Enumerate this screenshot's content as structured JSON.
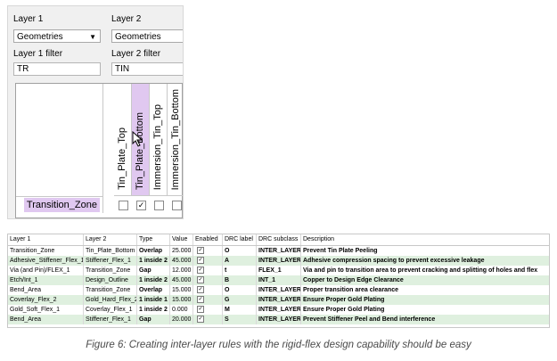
{
  "selector": {
    "layer1_label": "Layer 1",
    "layer2_label": "Layer 2",
    "layer1_value": "Geometries",
    "layer2_value": "Geometries",
    "layer1_filter_label": "Layer 1 filter",
    "layer2_filter_label": "Layer 2 filter",
    "layer1_filter_value": "TR",
    "layer2_filter_value": "TIN"
  },
  "matrix": {
    "columns": [
      "Tin_Plate_Top",
      "Tin_Plate_Bottom",
      "Immersion_Tin_Top",
      "Immersion_Tin_Bottom"
    ],
    "row": "Transition_Zone",
    "checked": [
      false,
      true,
      false,
      false
    ],
    "selected_column": 1,
    "check_glyph": "✓"
  },
  "table": {
    "headers": [
      "Layer 1",
      "Layer 2",
      "Type",
      "Value",
      "Enabled",
      "DRC label",
      "DRC subclass",
      "Description"
    ],
    "rows": [
      [
        "Transition_Zone",
        "Tin_Plate_Bottom",
        "Overlap",
        "25.000",
        "✓",
        "O",
        "INTER_LAYER",
        "Prevent Tin Plate Peeling"
      ],
      [
        "Adhesive_Stiffener_Flex_1",
        "Stiffener_Flex_1",
        "1 inside 2",
        "45.000",
        "✓",
        "A",
        "INTER_LAYER",
        "Adhesive compression spacing to prevent excessive leakage"
      ],
      [
        "Via (and Pin)/FLEX_1",
        "Transition_Zone",
        "Gap",
        "12.000",
        "✓",
        "t",
        "FLEX_1",
        "Via and pin to transition area to prevent cracking and splitting of holes and flex"
      ],
      [
        "Etch/Int_1",
        "Design_Outline",
        "1 inside 2",
        "45.000",
        "✓",
        "B",
        "INT_1",
        "Copper to Design Edge Clearance"
      ],
      [
        "Bend_Area",
        "Transition_Zone",
        "Overlap",
        "15.000",
        "✓",
        "O",
        "INTER_LAYER",
        "Proper transition area clearance"
      ],
      [
        "Coverlay_Flex_2",
        "Gold_Hard_Flex_2",
        "1 inside 1",
        "15.000",
        "✓",
        "G",
        "INTER_LAYER",
        "Ensure Proper Gold Plating"
      ],
      [
        "Gold_Soft_Flex_1",
        "Coverlay_Flex_1",
        "1 inside 2",
        "0.000",
        "✓",
        "M",
        "INTER_LAYER",
        "Ensure Proper Gold Plating"
      ],
      [
        "Bend_Area",
        "Stiffener_Flex_1",
        "Gap",
        "20.000",
        "✓",
        "S",
        "INTER_LAYER",
        "Prevent Stiffener Peel and Bend interference"
      ]
    ]
  },
  "caption": "Figure 6: Creating inter-layer rules with the rigid-flex design capability should be easy",
  "colors": {
    "highlight": "#e0c8f0",
    "row_alt": "#dff0df",
    "panel_bg": "#f0f0f0"
  }
}
